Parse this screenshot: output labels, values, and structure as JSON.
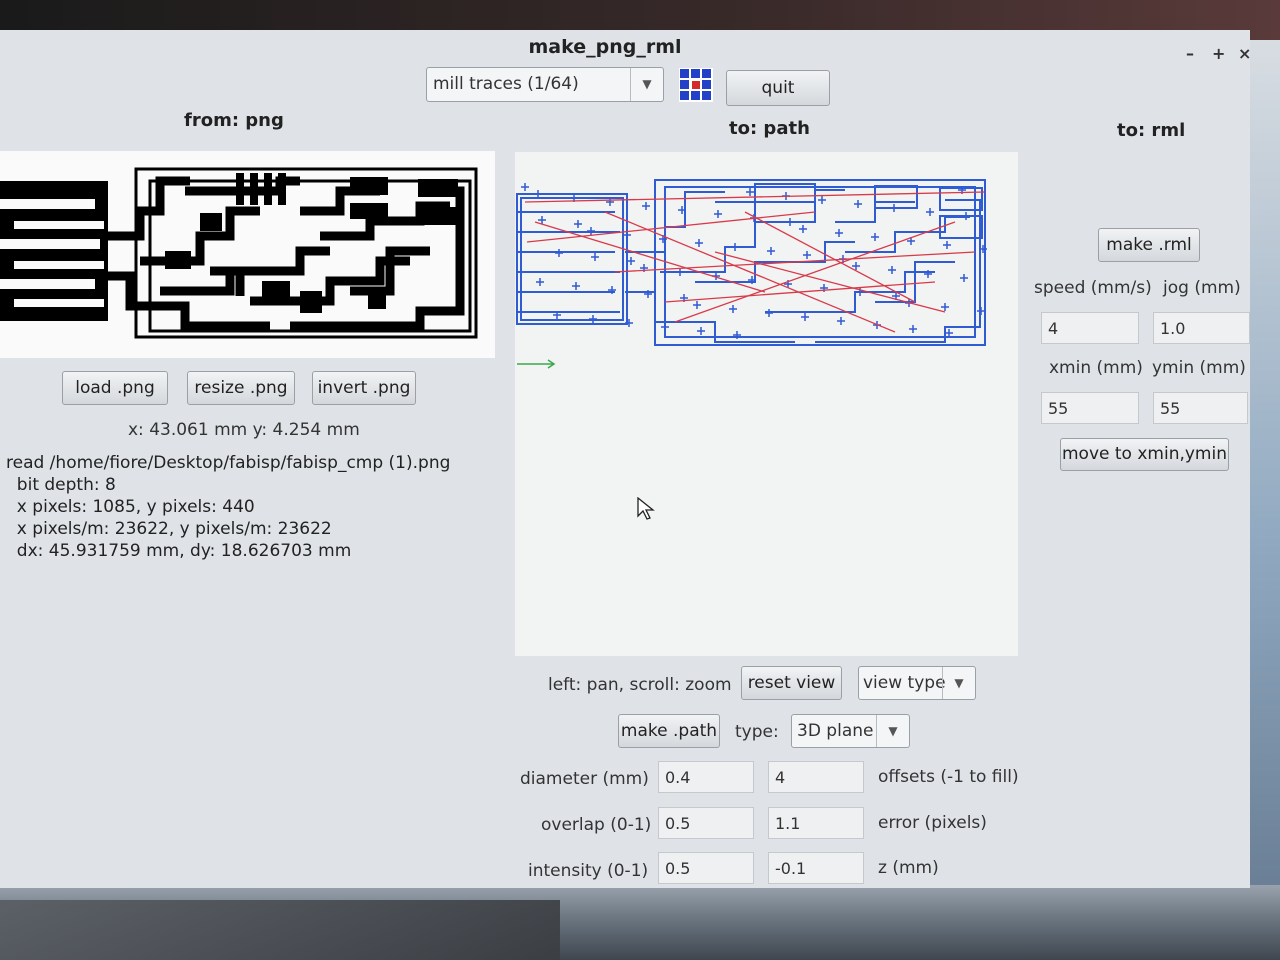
{
  "window": {
    "title": "make_png_rml",
    "controls": {
      "minimize": "–",
      "maximize": "+",
      "close": "×"
    }
  },
  "toolbar": {
    "process": "mill traces (1/64)",
    "quit": "quit"
  },
  "from_panel": {
    "heading": "from: png",
    "load": "load .png",
    "resize": "resize .png",
    "invert": "invert .png",
    "coords": "x: 43.061 mm  y: 4.254 mm",
    "info": [
      "read /home/fiore/Desktop/fabisp/fabisp_cmp (1).png",
      "  bit depth: 8",
      "  x pixels: 1085, y pixels: 440",
      "  x pixels/m: 23622, y pixels/m: 23622",
      "  dx: 45.931759 mm, dy: 18.626703 mm"
    ]
  },
  "path_panel": {
    "heading": "to: path",
    "help": "left: pan, scroll: zoom",
    "reset_view": "reset view",
    "view_type": "view type",
    "make_path": "make .path",
    "type_label": "type:",
    "type_value": "3D plane",
    "diameter_label": "diameter (mm)",
    "diameter": "0.4",
    "offsets": "4",
    "offsets_label": "offsets (-1 to fill)",
    "overlap_label": "overlap (0-1)",
    "overlap": "0.5",
    "error": "1.1",
    "error_label": "error (pixels)",
    "intensity_label": "intensity (0-1)",
    "intensity": "0.5",
    "z": "-0.1",
    "z_label": "z (mm)",
    "colors": {
      "path": "#2f5bd3",
      "move": "#d83a4a",
      "axis": "#3aa84a"
    }
  },
  "rml_panel": {
    "heading": "to: rml",
    "make_rml": "make .rml",
    "speed_label": "speed (mm/s)",
    "jog_label": "jog (mm)",
    "speed": "4",
    "jog": "1.0",
    "xmin_label": "xmin (mm)",
    "ymin_label": "ymin (mm)",
    "xmin": "55",
    "ymin": "55",
    "move": "move to xmin,ymin"
  }
}
